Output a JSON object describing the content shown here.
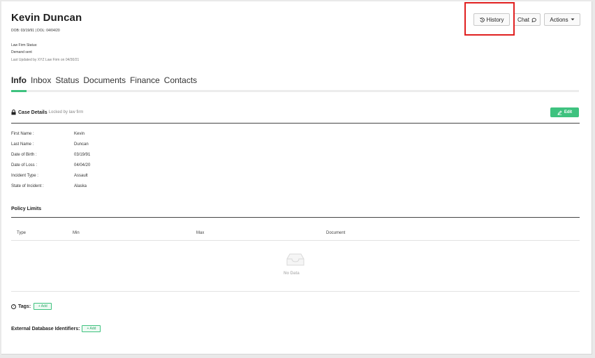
{
  "case": {
    "name": "Kevin Duncan",
    "dob_dol": "DOB: 03/19/91 | DOL: 04/04/20",
    "law_firm_status": "Law Firm Status:",
    "demand_status": "Demand sent",
    "last_updated": "Last Updated by XYZ Law Firm on 04/30/21"
  },
  "header_buttons": {
    "history": "History",
    "chat": "Chat",
    "actions": "Actions"
  },
  "tabs": [
    {
      "label": "Info",
      "active": true
    },
    {
      "label": "Inbox",
      "active": false
    },
    {
      "label": "Status",
      "active": false
    },
    {
      "label": "Documents",
      "active": false
    },
    {
      "label": "Finance",
      "active": false
    },
    {
      "label": "Contacts",
      "active": false
    }
  ],
  "case_details": {
    "title": "Case Details",
    "locked_note": "Locked by law firm",
    "edit_label": "Edit",
    "fields": [
      {
        "label": "First Name :",
        "value": "Kevin"
      },
      {
        "label": "Last Name :",
        "value": "Duncan"
      },
      {
        "label": "Date of Birth :",
        "value": "03/19/91"
      },
      {
        "label": "Date of Loss :",
        "value": "04/04/20"
      },
      {
        "label": "Incident Type :",
        "value": "Assault"
      },
      {
        "label": "State of Incident :",
        "value": "Alaska"
      }
    ]
  },
  "policy_limits": {
    "title": "Policy Limits",
    "columns": [
      "Type",
      "Min",
      "Max",
      "Document"
    ],
    "empty_text": "No Data"
  },
  "tags": {
    "label": "Tags:",
    "add_label": "+ Add"
  },
  "external_ids": {
    "label": "External Database Identifiers:",
    "add_label": "+ Add"
  },
  "colors": {
    "accent": "#3ec27f",
    "highlight": "#e02020"
  }
}
